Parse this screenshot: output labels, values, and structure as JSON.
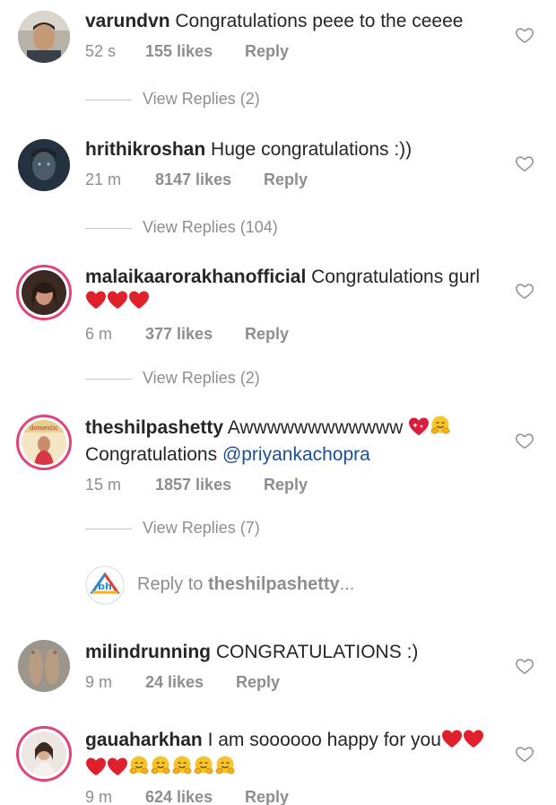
{
  "comments": [
    {
      "username": "varundvn",
      "text": "Congratulations peee to the ceeee",
      "time": "52 s",
      "likes": "155 likes",
      "reply": "Reply",
      "view_replies": "View Replies (2)"
    },
    {
      "username": "hrithikroshan",
      "text": "Huge congratulations :))",
      "time": "21 m",
      "likes": "8147 likes",
      "reply": "Reply",
      "view_replies": "View Replies (104)"
    },
    {
      "username": "malaikaarorakhanofficial",
      "text": "Congratulations gurl",
      "time": "6 m",
      "likes": "377 likes",
      "reply": "Reply",
      "view_replies": "View Replies (2)"
    },
    {
      "username": "theshilpashetty",
      "text": "Awwwwwwwwwwww",
      "text2": "Congratulations",
      "mention": "@priyankachopra",
      "time": "15 m",
      "likes": "1857 likes",
      "reply": "Reply",
      "view_replies": "View Replies (7)"
    },
    {
      "username": "milindrunning",
      "text": "CONGRATULATIONS :)",
      "time": "9 m",
      "likes": "24 likes",
      "reply": "Reply"
    },
    {
      "username": "gauaharkhan",
      "text": "I am soooooo happy for you",
      "time": "9 m",
      "likes": "624 likes",
      "reply": "Reply"
    }
  ],
  "reply_input": {
    "prefix": "Reply to ",
    "target": "theshilpashetty",
    "suffix": "..."
  },
  "colors": {
    "username": "#262626",
    "meta": "#8e8e8e",
    "mention": "#1f4e8c",
    "story_ring": "#e0447a",
    "heart_emoji": "#e0202b"
  }
}
